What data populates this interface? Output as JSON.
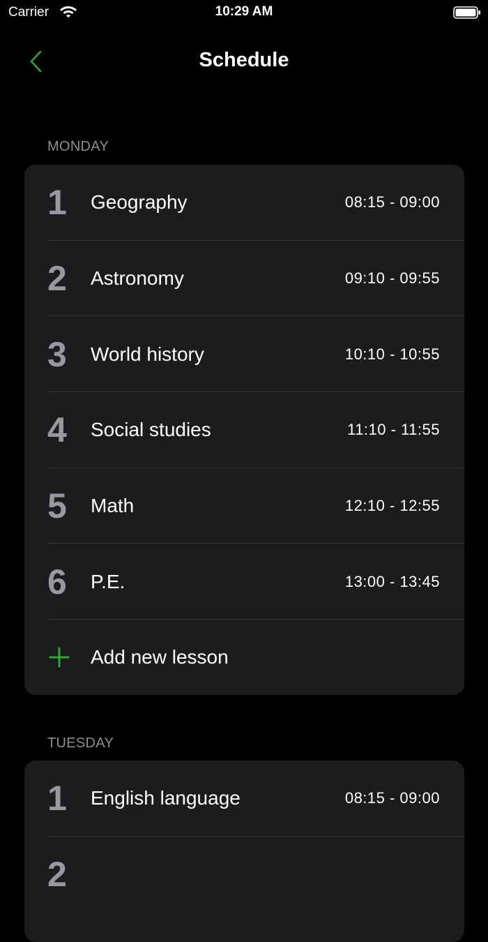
{
  "status_bar": {
    "carrier": "Carrier",
    "time": "10:29 AM",
    "wifi_icon": "wifi-icon",
    "battery_icon": "battery-full-icon"
  },
  "nav": {
    "title": "Schedule",
    "back_icon": "chevron-left-icon",
    "accent_color": "#34a53a"
  },
  "sections": [
    {
      "day": "MONDAY",
      "lessons": [
        {
          "number": "1",
          "name": "Geography",
          "time": "08:15 - 09:00"
        },
        {
          "number": "2",
          "name": "Astronomy",
          "time": "09:10 - 09:55"
        },
        {
          "number": "3",
          "name": "World history",
          "time": "10:10 - 10:55"
        },
        {
          "number": "4",
          "name": "Social studies",
          "time": "11:10 - 11:55"
        },
        {
          "number": "5",
          "name": "Math",
          "time": "12:10 - 12:55"
        },
        {
          "number": "6",
          "name": "P.E.",
          "time": "13:00 - 13:45"
        }
      ],
      "add_label": "Add new lesson"
    },
    {
      "day": "TUESDAY",
      "lessons": [
        {
          "number": "1",
          "name": "English language",
          "time": "08:15 - 09:00"
        },
        {
          "number": "2",
          "name": "",
          "time": ""
        }
      ]
    }
  ],
  "colors": {
    "background": "#000000",
    "card": "#1c1c1e",
    "secondary_text": "#8e8e93",
    "number_text": "#98989e"
  }
}
